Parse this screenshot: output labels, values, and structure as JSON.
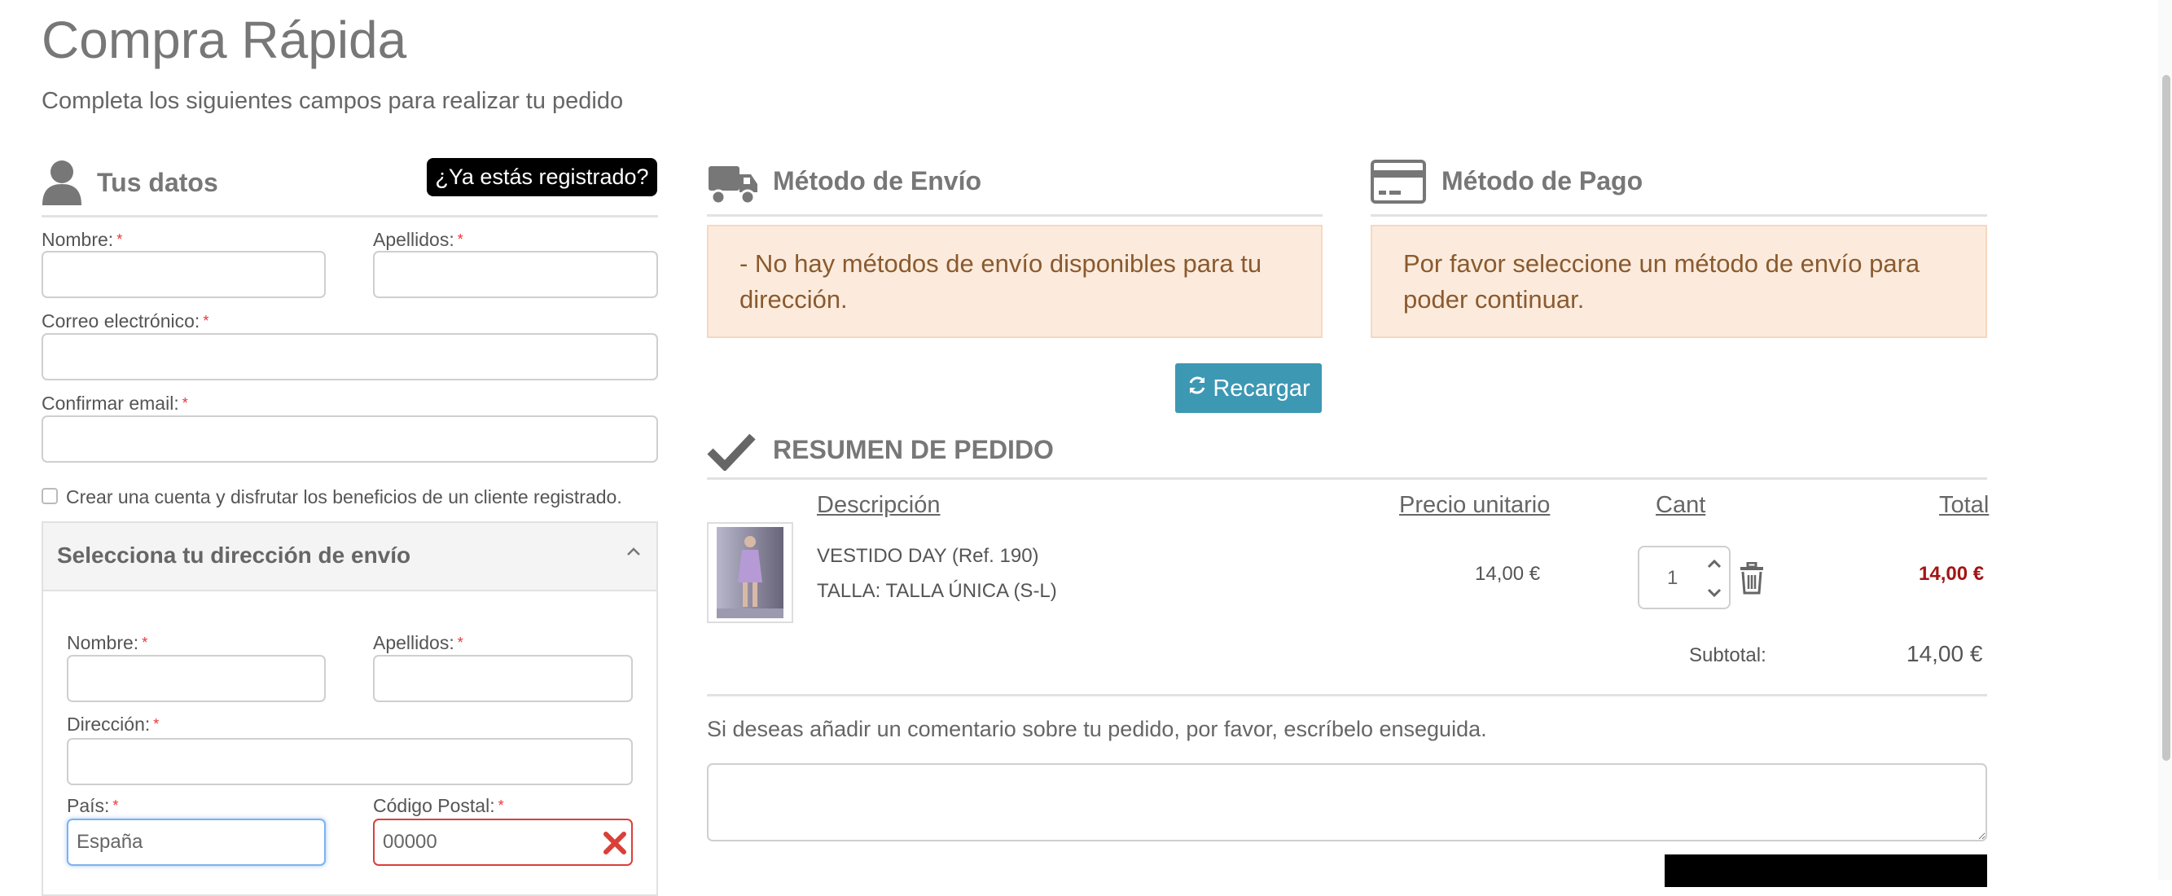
{
  "page": {
    "title": "Compra Rápida",
    "subtitle": "Completa los siguientes campos para realizar tu pedido"
  },
  "customer": {
    "heading": "Tus datos",
    "registered_button": "¿Ya estás registrado?",
    "nombre_label": "Nombre:",
    "apellidos_label": "Apellidos:",
    "email_label": "Correo electrónico:",
    "confirm_email_label": "Confirmar email:",
    "create_account_label": "Crear una cuenta y disfrutar los beneficios de un cliente registrado.",
    "required_mark": "*"
  },
  "address": {
    "heading": "Selecciona tu dirección de envío",
    "nombre_label": "Nombre:",
    "apellidos_label": "Apellidos:",
    "direccion_label": "Dirección:",
    "pais_label": "País:",
    "pais_value": "España",
    "cp_label": "Código Postal:",
    "cp_value": "00000"
  },
  "shipping": {
    "heading": "Método de Envío",
    "message": "- No hay métodos de envío disponibles para tu dirección.",
    "reload_button": "Recargar"
  },
  "payment": {
    "heading": "Método de Pago",
    "message": "Por favor seleccione un método de envío para poder continuar."
  },
  "summary": {
    "heading": "RESUMEN DE PEDIDO",
    "columns": [
      "Descripción",
      "Precio unitario",
      "Cant",
      "Total"
    ],
    "item": {
      "name": "VESTIDO DAY (Ref. 190)",
      "variant": "TALLA: TALLA ÚNICA (S-L)",
      "unit_price": "14,00 €",
      "quantity": "1",
      "total": "14,00 €"
    },
    "subtotal_label": "Subtotal:",
    "subtotal_value": "14,00 €",
    "comment_prompt": "Si deseas añadir un comentario sobre tu pedido, por favor, escríbelo enseguida."
  },
  "colors": {
    "accent_button": "#3d98b4",
    "alert_bg": "#fcebdc",
    "total_red": "#a31515",
    "error_red": "#d9403a"
  }
}
